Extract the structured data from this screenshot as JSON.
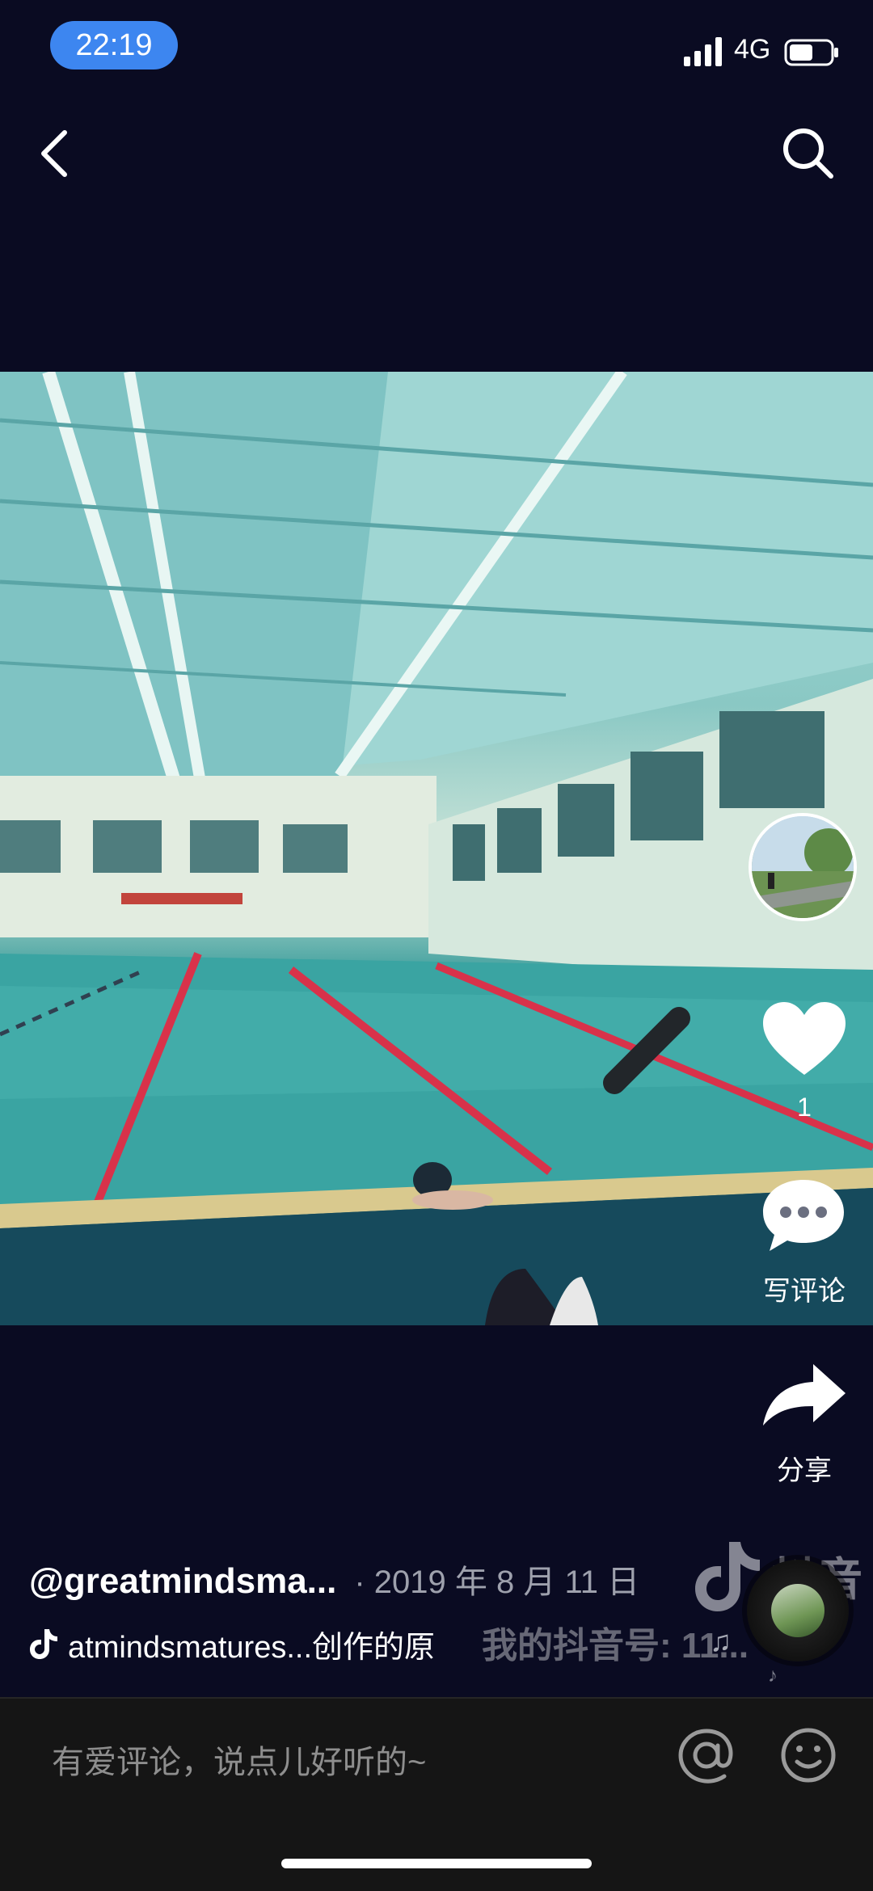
{
  "status_bar": {
    "time": "22:19",
    "network": "4G"
  },
  "actions": {
    "like_count": "1",
    "comment_label": "写评论",
    "share_label": "分享"
  },
  "post": {
    "author": "@greatmindsma...",
    "date": "· 2019 年 8 月 11 日",
    "music_text": "atmindsmatures...创作的原",
    "watermark_brand": "抖音",
    "watermark_id": "我的抖音号: 11..."
  },
  "comment_bar": {
    "placeholder": "有爱评论，说点儿好听的~"
  },
  "icons": {
    "back": "back-chevron-icon",
    "search": "search-icon",
    "heart": "heart-icon",
    "comment": "comment-bubble-icon",
    "share": "share-arrow-icon",
    "at": "at-sign-icon",
    "emoji": "smiley-icon"
  },
  "colors": {
    "background": "#0a0b22",
    "time_pill": "#3d86f0",
    "comment_bar": "#151515"
  }
}
